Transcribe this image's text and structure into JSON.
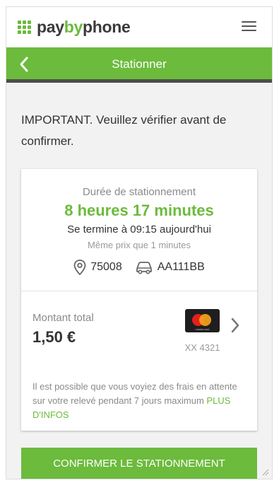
{
  "header": {
    "logo": {
      "pay": "pay",
      "by": "by",
      "phone": "phone"
    },
    "menu_icon": "hamburger-menu-icon"
  },
  "titlebar": {
    "title": "Stationner",
    "back_icon": "chevron-left-icon"
  },
  "notice": "IMPORTANT. Veuillez vérifier avant de confirmer.",
  "summary": {
    "duration_label": "Durée de stationnement",
    "duration_value": "8 heures 17 minutes",
    "end_time": "Se termine à 09:15 aujourd'hui",
    "same_price": "Même prix que 1 minutes",
    "location": "75008",
    "plate": "AA111BB"
  },
  "payment": {
    "total_label": "Montant total",
    "total_value": "1,50 €",
    "card_brand": "mastercard",
    "card_logo_text": "mastercard",
    "card_number": "XX 4321"
  },
  "fees": {
    "text": "Il est possible que vous voyiez des frais en attente sur votre relevé pendant 7 jours maximum",
    "more_link": "PLUS D'INFOS"
  },
  "confirm_button": "CONFIRMER LE STATIONNEMENT",
  "colors": {
    "brand_green": "#6cbb3c",
    "dark_bar": "#4d4d4d"
  }
}
